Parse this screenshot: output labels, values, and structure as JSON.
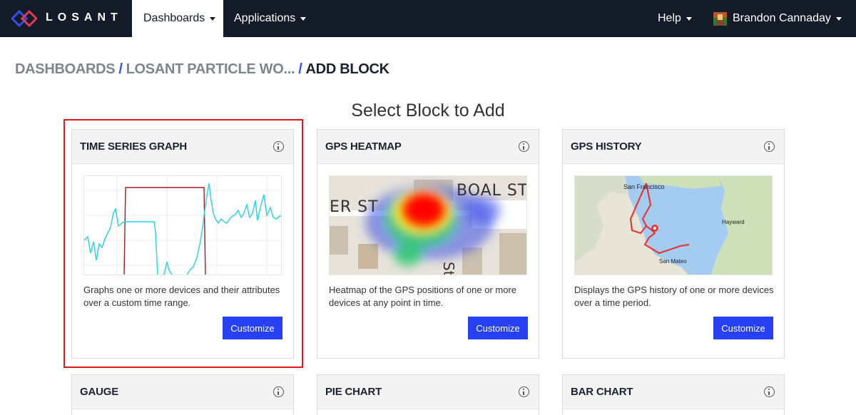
{
  "navbar": {
    "logo_text": "LOSANT",
    "menu": [
      {
        "label": "Dashboards",
        "active": true
      },
      {
        "label": "Applications",
        "active": false
      }
    ],
    "help_label": "Help",
    "user_name": "Brandon Cannaday"
  },
  "breadcrumb": [
    "DASHBOARDS",
    "LOSANT PARTICLE WO...",
    "ADD BLOCK"
  ],
  "page_heading": "Select Block to Add",
  "cards": [
    {
      "title": "TIME SERIES GRAPH",
      "description": "Graphs one or more devices and their attributes over a custom time range.",
      "button": "Customize",
      "selected": true
    },
    {
      "title": "GPS HEATMAP",
      "description": "Heatmap of the GPS positions of one or more devices at any point in time.",
      "button": "Customize",
      "map_labels": [
        "ER ST",
        "BOAL ST",
        "St"
      ]
    },
    {
      "title": "GPS HISTORY",
      "description": "Displays the GPS history of one or more devices over a time period.",
      "button": "Customize",
      "map_labels": [
        "San Francisco",
        "Hayward",
        "San Mateo"
      ]
    },
    {
      "title": "GAUGE"
    },
    {
      "title": "PIE CHART"
    },
    {
      "title": "BAR CHART"
    }
  ],
  "colors": {
    "navbar_bg": "#131b28",
    "accent_blue": "#2741f2",
    "selection_red": "#e01b1b",
    "line_cyan": "#22d3e6",
    "line_maroon": "#a31b1b"
  }
}
